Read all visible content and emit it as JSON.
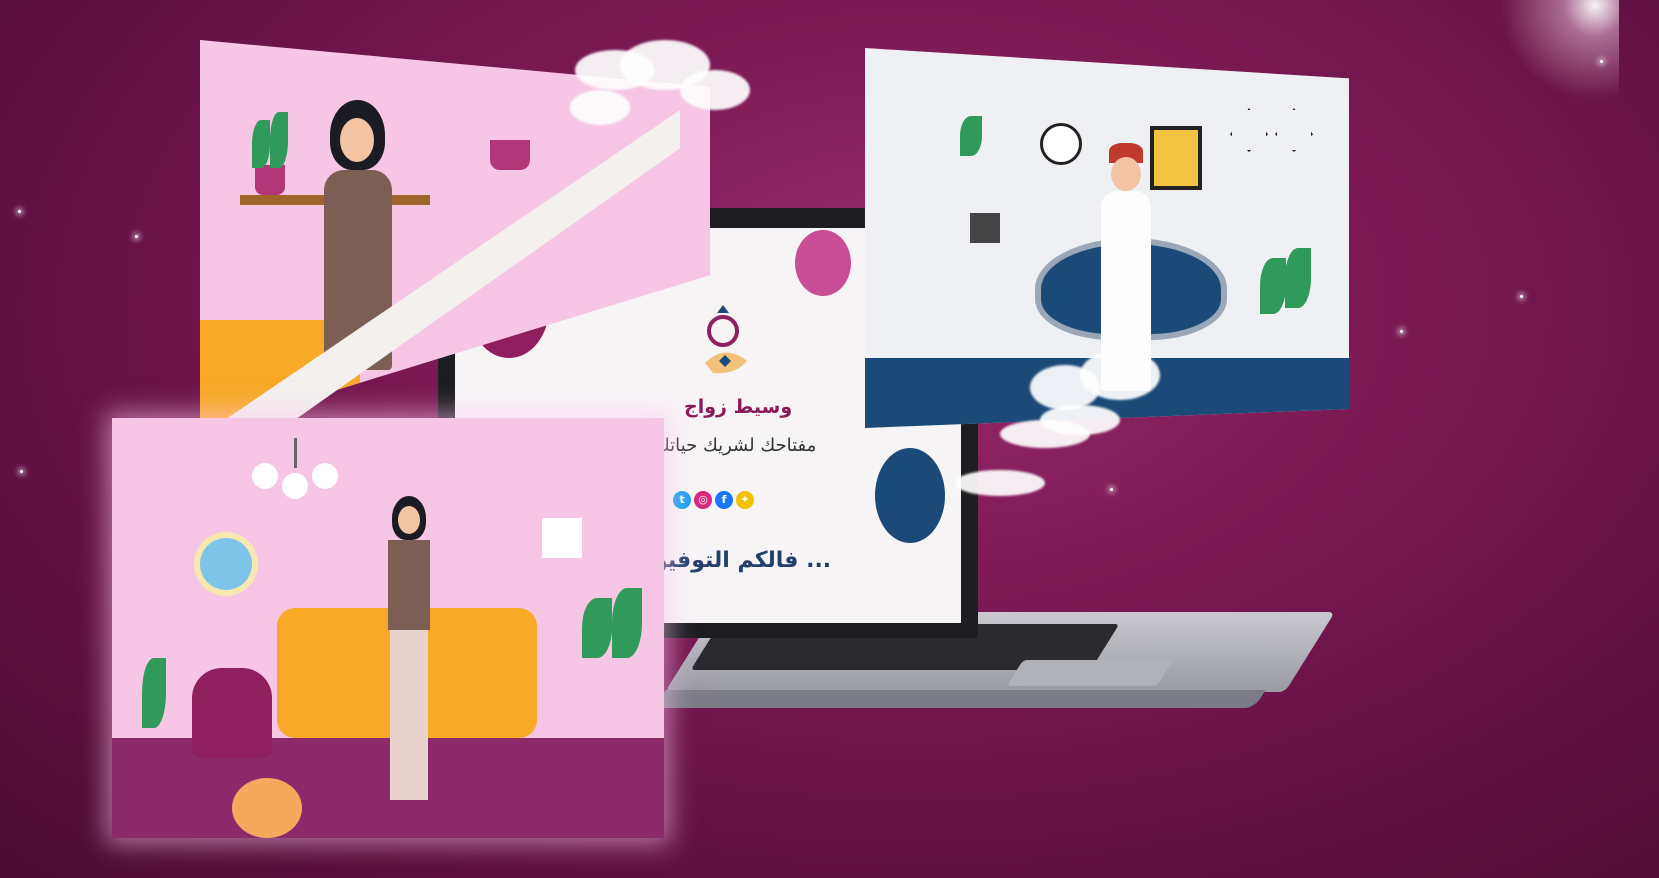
{
  "brand": {
    "name": "وسيط زواج",
    "tagline": "مفتاحك لشريك حياتك",
    "closing": "فالكم التوفيق ..."
  },
  "social_icons": [
    {
      "name": "twitter-icon",
      "glyph": "t",
      "color": "#1da1f2"
    },
    {
      "name": "instagram-icon",
      "glyph": "◎",
      "color": "#d6287f"
    },
    {
      "name": "facebook-icon",
      "glyph": "f",
      "color": "#1877f2"
    },
    {
      "name": "snapchat-icon",
      "glyph": "✦",
      "color": "#f2c200"
    }
  ],
  "colors": {
    "background": "#7c1a55",
    "accent_magenta": "#8f1f5e",
    "accent_pink": "#c94e96",
    "accent_navy": "#1c4a78",
    "sofa": "#f7a927"
  }
}
